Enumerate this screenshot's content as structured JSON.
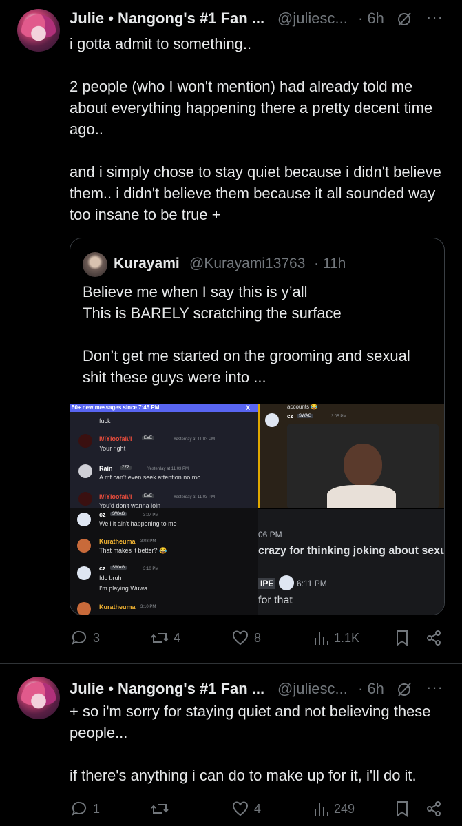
{
  "tweet1": {
    "name": "Julie • Nangong's #1 Fan ...",
    "handle": "@juliesc...",
    "time": "· 6h",
    "more": "···",
    "text": "i gotta admit to something..\n\n2 people (who I won't mention) had already told me about everything happening there a pretty decent time ago..\n\nand i simply chose to stay quiet because i didn't believe them.. i didn't believe them because it all sounded way too insane to be true +",
    "quote": {
      "name": "Kurayami",
      "handle": "@Kurayami13763",
      "time": "· 11h",
      "text": "Believe me when I say this is y’all\nThis is BARELY scratching the surface\n\nDon’t get me started on the grooming and sexual shit these guys were into ...",
      "media": {
        "left": {
          "banner": "50+ new messages since 7:45 PM",
          "banner_close": "X",
          "first_line": "fuck",
          "messages": [
            {
              "name": "l\\/lYloofal\\/l",
              "tag": "EVE",
              "time": "Yesterday at 11:03 PM",
              "text": "Your right",
              "color": "#e74c3c"
            },
            {
              "name": "Rain",
              "tag": "ZZZ",
              "time": "Yesterday at 11:03 PM",
              "text": "A mf can't even seek attention no mo",
              "color": "#ffffff"
            },
            {
              "name": "l\\/lYloofal\\/l",
              "tag": "EVE",
              "time": "Yesterday at 11:03 PM",
              "text": "You'd don't wanna join",
              "color": "#e74c3c"
            },
            {
              "name": "cz",
              "tag": "SWAG",
              "time": "3:07 PM",
              "text": "Well it ain't happening to me",
              "color": "#ffffff"
            },
            {
              "name": "Kuratheuma",
              "tag": "",
              "time": "3:08 PM",
              "text": "That makes it better? 😂",
              "color": "#f0b232"
            },
            {
              "name": "cz",
              "tag": "SWAG",
              "time": "3:10 PM",
              "text": "Idc bruh",
              "text2": "I'm playing Wuwa",
              "color": "#ffffff"
            },
            {
              "name": "Kuratheuma",
              "tag": "",
              "time": "3:10 PM",
              "text": "",
              "color": "#f0b232"
            }
          ]
        },
        "right_top": {
          "accounts": "accounts 😂",
          "name": "cz",
          "tag": "SWAG",
          "time": "3:05 PM"
        },
        "right_bottom": {
          "time_frag": "06 PM",
          "line1": "crazy for thinking joking about sexu",
          "tag": "IPE",
          "time2": "6:11 PM",
          "line2": "for that"
        }
      }
    },
    "actions": {
      "replies": "3",
      "reposts": "4",
      "likes": "8",
      "views": "1.1K"
    }
  },
  "tweet2": {
    "name": "Julie • Nangong's #1 Fan ...",
    "handle": "@juliesc...",
    "time": "· 6h",
    "more": "···",
    "text": "+ so i'm sorry for staying quiet and not believing these people...\n\nif there's anything i can do to make up for it, i'll do it.",
    "actions": {
      "replies": "1",
      "reposts": "",
      "likes": "4",
      "views": "249"
    }
  },
  "colors": {
    "background": "#000000",
    "text": "#e7e9ea",
    "muted": "#71767b",
    "border": "#2f3336",
    "discord_blue": "#5865f2"
  }
}
